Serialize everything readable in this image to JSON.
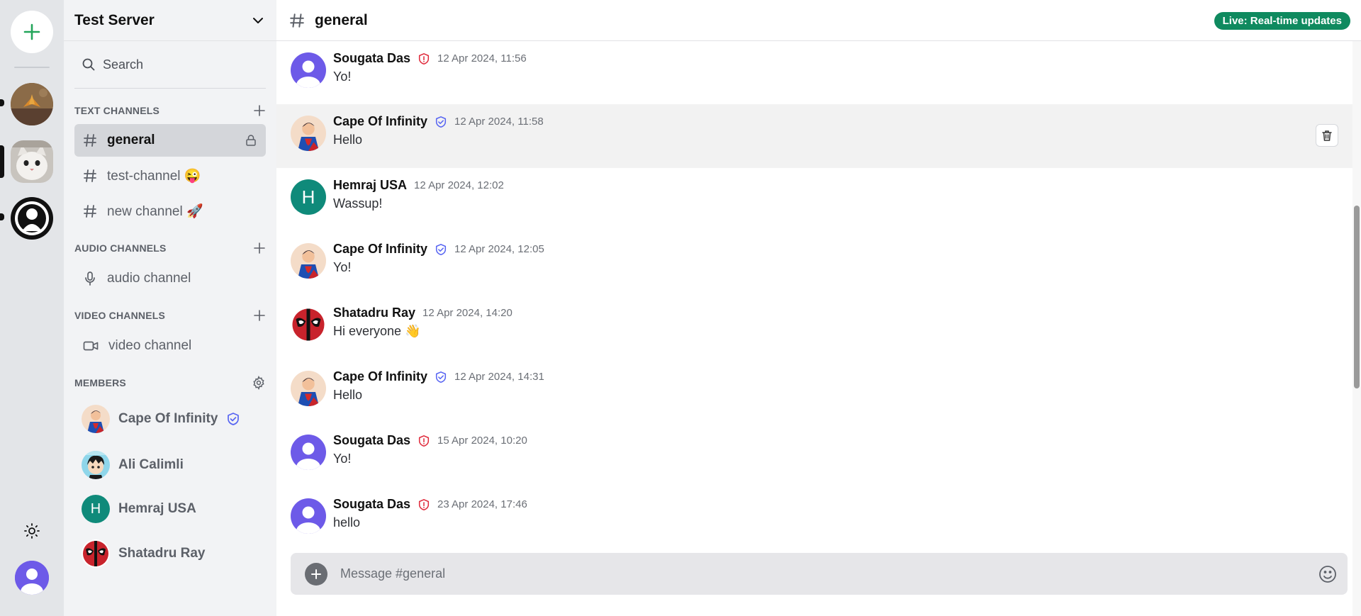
{
  "server": {
    "name": "Test Server"
  },
  "search": {
    "label": "Search"
  },
  "sections": {
    "text": "TEXT CHANNELS",
    "audio": "AUDIO CHANNELS",
    "video": "VIDEO CHANNELS",
    "members": "MEMBERS"
  },
  "channels": {
    "text": [
      {
        "label": "general",
        "icon": "hash-icon",
        "active": true
      },
      {
        "label": "test-channel 😜",
        "icon": "hash-icon"
      },
      {
        "label": "new channel 🚀",
        "icon": "hash-icon"
      }
    ],
    "audio": [
      {
        "label": "audio channel",
        "icon": "mic-icon"
      }
    ],
    "video": [
      {
        "label": "video channel",
        "icon": "video-icon"
      }
    ]
  },
  "members": [
    {
      "name": "Cape Of Infinity",
      "badge": "moderator-shield-icon"
    },
    {
      "name": "Ali Calimli"
    },
    {
      "name": "Hemraj USA",
      "initial": "H"
    },
    {
      "name": "Shatadru Ray"
    }
  ],
  "header": {
    "channel": "general",
    "badge": "Live: Real-time updates"
  },
  "messages": [
    {
      "author": "Sougata Das",
      "role": "admin",
      "time": "12 Apr 2024, 11:56",
      "text": "Yo!"
    },
    {
      "author": "Cape Of Infinity",
      "role": "moderator",
      "time": "12 Apr 2024, 11:58",
      "text": "Hello"
    },
    {
      "author": "Hemraj USA",
      "role": "",
      "time": "12 Apr 2024, 12:02",
      "text": "Wassup!"
    },
    {
      "author": "Cape Of Infinity",
      "role": "moderator",
      "time": "12 Apr 2024, 12:05",
      "text": "Yo!"
    },
    {
      "author": "Shatadru Ray",
      "role": "",
      "time": "12 Apr 2024, 14:20",
      "text": "Hi everyone 👋"
    },
    {
      "author": "Cape Of Infinity",
      "role": "moderator",
      "time": "12 Apr 2024, 14:31",
      "text": "Hello"
    },
    {
      "author": "Sougata Das",
      "role": "admin",
      "time": "15 Apr 2024, 10:20",
      "text": "Yo!"
    },
    {
      "author": "Sougata Das",
      "role": "admin",
      "time": "23 Apr 2024, 17:46",
      "text": "hello"
    }
  ],
  "composer": {
    "placeholder": "Message #general"
  },
  "colors": {
    "accent_green": "#0f8a5f",
    "admin_red": "#e02b3c",
    "moderator_blue": "#5865f2",
    "avatar_purple": "#6d5ae8",
    "hemraj_teal": "#0f8a7a"
  }
}
